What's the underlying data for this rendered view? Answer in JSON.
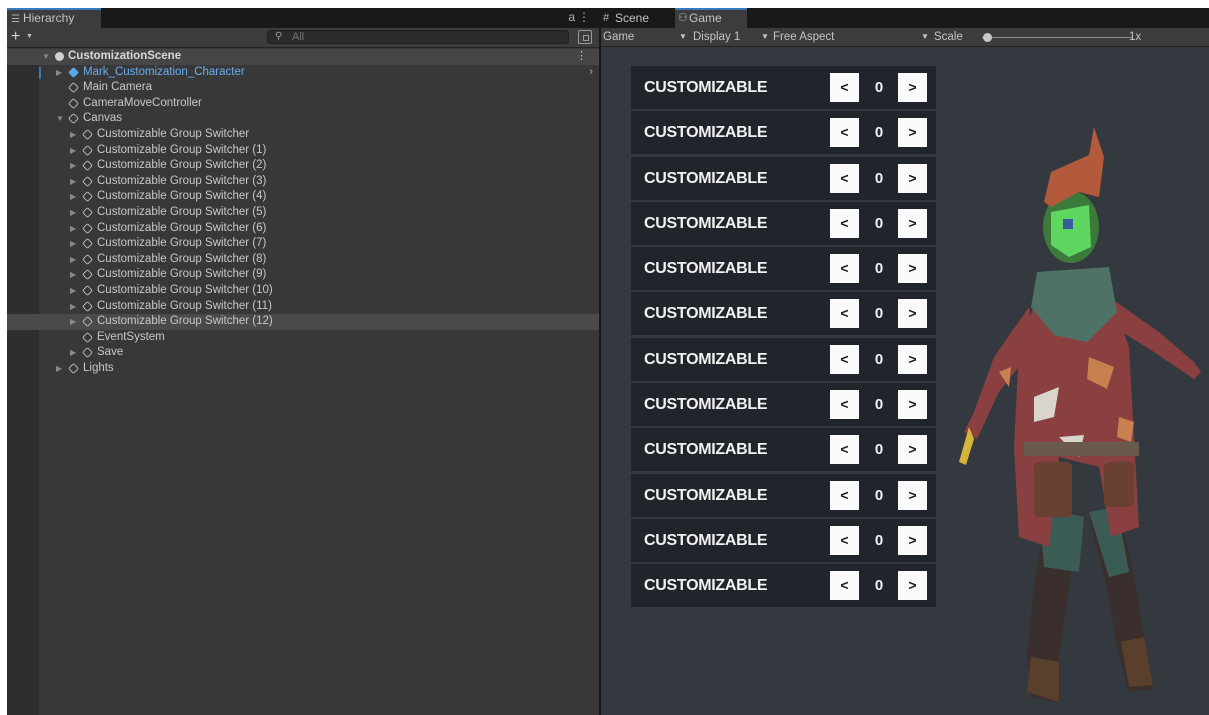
{
  "hierarchy": {
    "tab_label": "Hierarchy",
    "tab_icon": "list-icon",
    "search": {
      "placeholder": "All",
      "value": ""
    },
    "scene_name": "CustomizationScene",
    "items": [
      {
        "label": "Mark_Customization_Character",
        "icon": "prefab-icon",
        "selected_prefab": true
      },
      {
        "label": "Main Camera",
        "icon": "gameobject-icon"
      },
      {
        "label": "CameraMoveController",
        "icon": "gameobject-icon"
      },
      {
        "label": "Canvas",
        "icon": "gameobject-icon",
        "expanded": true
      },
      {
        "label": "Customizable Group Switcher"
      },
      {
        "label": "Customizable Group Switcher (1)"
      },
      {
        "label": "Customizable Group Switcher (2)"
      },
      {
        "label": "Customizable Group Switcher (3)"
      },
      {
        "label": "Customizable Group Switcher (4)"
      },
      {
        "label": "Customizable Group Switcher (5)"
      },
      {
        "label": "Customizable Group Switcher (6)"
      },
      {
        "label": "Customizable Group Switcher (7)"
      },
      {
        "label": "Customizable Group Switcher (8)"
      },
      {
        "label": "Customizable Group Switcher (9)"
      },
      {
        "label": "Customizable Group Switcher (10)"
      },
      {
        "label": "Customizable Group Switcher (11)"
      },
      {
        "label": "Customizable Group Switcher (12)",
        "highlighted": true
      },
      {
        "label": "EventSystem"
      },
      {
        "label": "Save"
      },
      {
        "label": "Lights"
      }
    ]
  },
  "game_view": {
    "tabs": [
      {
        "label": "Scene",
        "icon": "hash-icon"
      },
      {
        "label": "Game",
        "icon": "gamepad-icon",
        "active": true
      }
    ],
    "toolbar": {
      "mode": "Game",
      "display": "Display 1",
      "aspect": "Free Aspect",
      "scale_label": "Scale",
      "scale_value": "1x"
    },
    "customizations": [
      {
        "label": "CUSTOMIZABLE",
        "value": "0",
        "prev": "<",
        "next": ">"
      },
      {
        "label": "CUSTOMIZABLE",
        "value": "0",
        "prev": "<",
        "next": ">"
      },
      {
        "label": "CUSTOMIZABLE",
        "value": "0",
        "prev": "<",
        "next": ">"
      },
      {
        "label": "CUSTOMIZABLE",
        "value": "0",
        "prev": "<",
        "next": ">"
      },
      {
        "label": "CUSTOMIZABLE",
        "value": "0",
        "prev": "<",
        "next": ">"
      },
      {
        "label": "CUSTOMIZABLE",
        "value": "0",
        "prev": "<",
        "next": ">"
      },
      {
        "label": "CUSTOMIZABLE",
        "value": "0",
        "prev": "<",
        "next": ">"
      },
      {
        "label": "CUSTOMIZABLE",
        "value": "0",
        "prev": "<",
        "next": ">"
      },
      {
        "label": "CUSTOMIZABLE",
        "value": "0",
        "prev": "<",
        "next": ">"
      },
      {
        "label": "CUSTOMIZABLE",
        "value": "0",
        "prev": "<",
        "next": ">"
      },
      {
        "label": "CUSTOMIZABLE",
        "value": "0",
        "prev": "<",
        "next": ">"
      },
      {
        "label": "CUSTOMIZABLE",
        "value": "0",
        "prev": "<",
        "next": ">"
      }
    ]
  },
  "colors": {
    "accent": "#3a79bb",
    "prefab_blue": "#6aaef0",
    "viewport_bg": "#33393f",
    "row_bg": "#1f252b"
  }
}
